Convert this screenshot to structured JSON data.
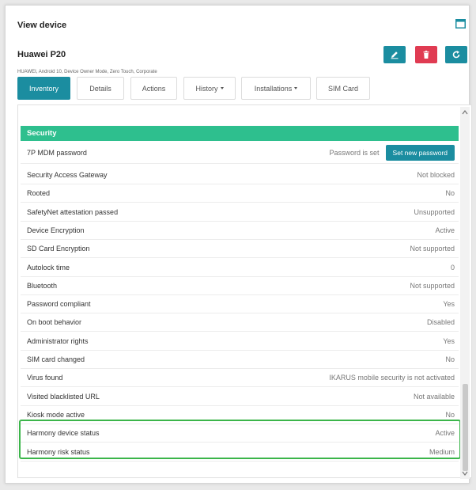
{
  "window": {
    "title": "View device"
  },
  "device": {
    "name": "Huawei P20",
    "meta": "HUAWEI, Android 10, Device Owner Mode, Zero Touch, Corporate"
  },
  "colors": {
    "accent": "#1b8da0",
    "danger": "#e03b52",
    "section": "#2ebf8e",
    "highlight": "#3bb54a"
  },
  "actions": [
    {
      "icon": "edit-icon"
    },
    {
      "icon": "trash-icon"
    },
    {
      "icon": "refresh-icon"
    }
  ],
  "tabs": [
    {
      "label": "Inventory",
      "active": true
    },
    {
      "label": "Details"
    },
    {
      "label": "Actions"
    },
    {
      "label": "History",
      "dropdown": true
    },
    {
      "label": "Installations",
      "dropdown": true
    },
    {
      "label": "SIM Card"
    }
  ],
  "security": {
    "title": "Security",
    "password": {
      "label": "7P MDM password",
      "status": "Password is set",
      "button": "Set new password"
    },
    "rows": [
      {
        "label": "Security Access Gateway",
        "value": "Not blocked"
      },
      {
        "label": "Rooted",
        "value": "No"
      },
      {
        "label": "SafetyNet attestation passed",
        "value": "Unsupported"
      },
      {
        "label": "Device Encryption",
        "value": "Active"
      },
      {
        "label": "SD Card Encryption",
        "value": "Not supported"
      },
      {
        "label": "Autolock time",
        "value": "0"
      },
      {
        "label": "Bluetooth",
        "value": "Not supported"
      },
      {
        "label": "Password compliant",
        "value": "Yes"
      },
      {
        "label": "On boot behavior",
        "value": "Disabled"
      },
      {
        "label": "Administrator rights",
        "value": "Yes"
      },
      {
        "label": "SIM card changed",
        "value": "No"
      },
      {
        "label": "Virus found",
        "value": "IKARUS mobile security is not activated"
      },
      {
        "label": "Visited blacklisted URL",
        "value": "Not available"
      },
      {
        "label": "Kiosk mode active",
        "value": "No"
      },
      {
        "label": "Harmony device status",
        "value": "Active"
      },
      {
        "label": "Harmony risk status",
        "value": "Medium"
      }
    ]
  }
}
